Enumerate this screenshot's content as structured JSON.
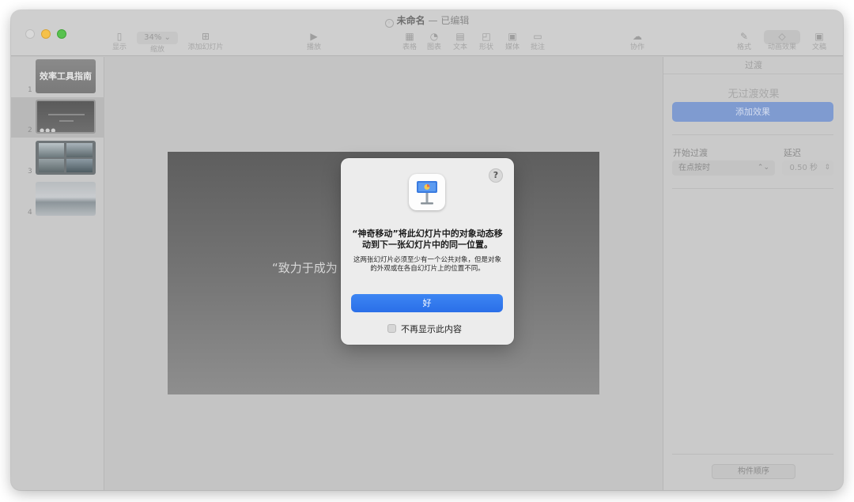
{
  "window": {
    "title_name": "未命名",
    "title_status": "— 已编辑"
  },
  "toolbar": {
    "view": "显示",
    "zoom_value": "34% ⌄",
    "zoom": "缩放",
    "add_slide": "添加幻灯片",
    "play": "播放",
    "table": "表格",
    "chart": "图表",
    "text": "文本",
    "shape": "形状",
    "media": "媒体",
    "comment": "批注",
    "collaborate": "协作",
    "format": "格式",
    "animate": "动画效果",
    "document": "文稿"
  },
  "slides": [
    {
      "number": "1",
      "title": "效率工具指南"
    },
    {
      "number": "2"
    },
    {
      "number": "3"
    },
    {
      "number": "4"
    }
  ],
  "canvas": {
    "slide_text": "“致力于成为"
  },
  "inspector": {
    "header": "过渡",
    "no_effect": "无过渡效果",
    "add_effect": "添加效果",
    "start_label": "开始过渡",
    "delay_label": "延迟",
    "start_value": "在点按时",
    "delay_value": "0.50 秒",
    "build_order": "构件顺序"
  },
  "dialog": {
    "help": "?",
    "title": "“神奇移动”将此幻灯片中的对象动态移动到下一张幻灯片中的同一位置。",
    "body": "这两张幻灯片必须至少有一个公共对象，但是对象的外观或在各自幻灯片上的位置不同。",
    "ok": "好",
    "dont_show": "不再显示此内容"
  }
}
